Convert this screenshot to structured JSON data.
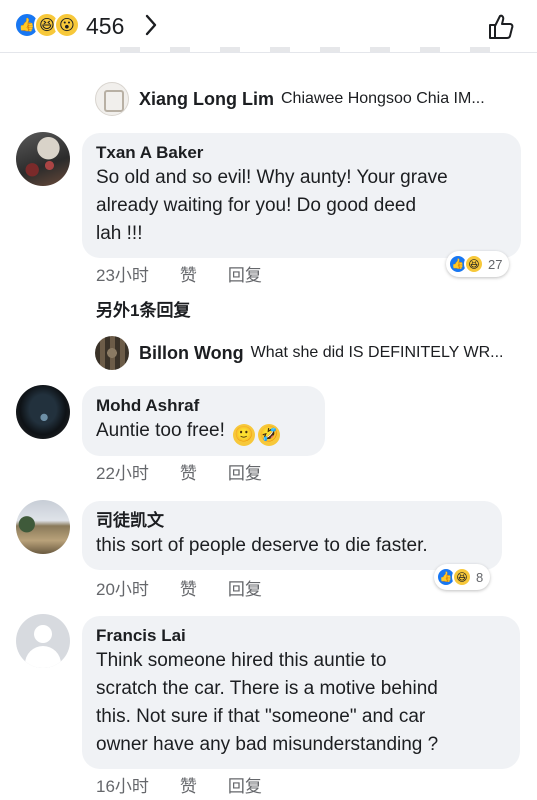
{
  "header": {
    "reaction_icons": [
      "like-icon",
      "haha-icon",
      "wow-icon"
    ],
    "reaction_count": "456"
  },
  "replies": [
    {
      "name": "Xiang Long Lim",
      "text": "Chiawee Hongsoo Chia IM..."
    },
    {
      "name": "Billon Wong",
      "text": "What she did IS DEFINITELY WR..."
    }
  ],
  "comments": [
    {
      "name": "Txan A Baker",
      "lines": [
        "So old and so evil! Why aunty! Your grave",
        "already waiting for you! Do good deed",
        "lah !!!"
      ],
      "time": "23小时",
      "like_label": "赞",
      "reply_label": "回复",
      "reaction_count": "27"
    },
    {
      "name": "Mohd Ashraf",
      "lines": [
        "Auntie too free!"
      ],
      "time": "22小时",
      "like_label": "赞",
      "reply_label": "回复"
    },
    {
      "name": "司徒凯文",
      "lines": [
        "this sort of people deserve to die faster."
      ],
      "time": "20小时",
      "like_label": "赞",
      "reply_label": "回复",
      "reaction_count": "8"
    },
    {
      "name": "Francis Lai",
      "lines": [
        "Think someone hired this auntie to",
        "scratch the car. There is a motive behind",
        "this. Not sure if that \"someone\" and car",
        "owner have any bad misunderstanding ?"
      ],
      "time": "16小时",
      "like_label": "赞",
      "reply_label": "回复"
    }
  ],
  "more_replies": "另外1条回复",
  "colors": {
    "like_blue": "#1877f2",
    "bubble_bg": "#f0f2f5",
    "meta_gray": "#65676b",
    "emoji_yellow": "#f7c83a"
  }
}
